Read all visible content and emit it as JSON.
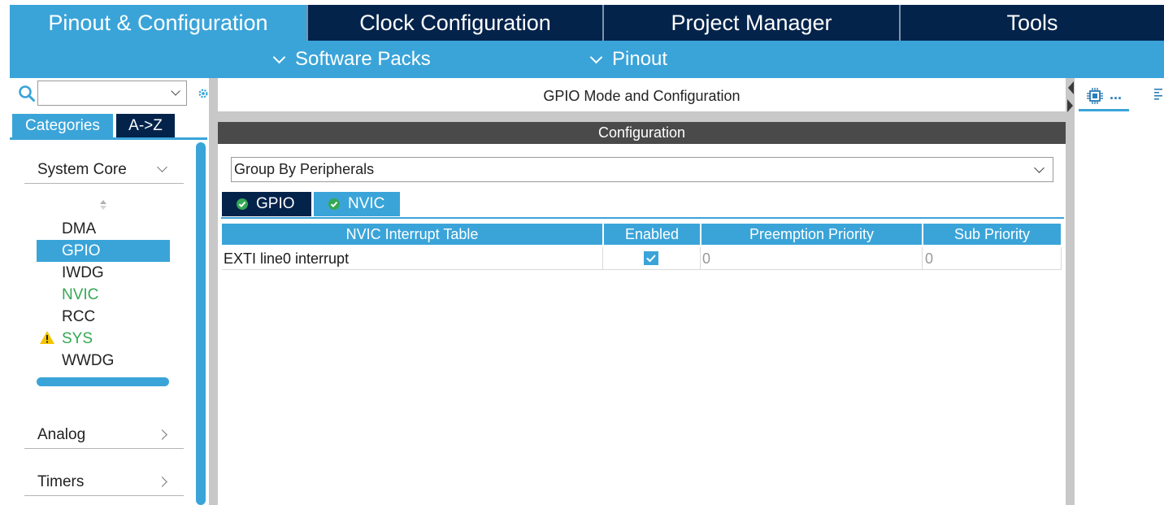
{
  "top_tabs": [
    {
      "label": "Pinout & Configuration",
      "active": true
    },
    {
      "label": "Clock Configuration",
      "active": false
    },
    {
      "label": "Project Manager",
      "active": false
    },
    {
      "label": "Tools",
      "active": false
    }
  ],
  "sub_menu": [
    "Software Packs",
    "Pinout"
  ],
  "left": {
    "search_value": "",
    "tabs": [
      {
        "label": "Categories",
        "active": true
      },
      {
        "label": "A->Z",
        "active": false
      }
    ],
    "categories": [
      {
        "label": "System Core",
        "expanded": true
      },
      {
        "label": "Analog",
        "expanded": false
      },
      {
        "label": "Timers",
        "expanded": false
      }
    ],
    "peripherals": [
      {
        "label": "DMA",
        "state": "normal"
      },
      {
        "label": "GPIO",
        "state": "selected"
      },
      {
        "label": "IWDG",
        "state": "normal"
      },
      {
        "label": "NVIC",
        "state": "configured"
      },
      {
        "label": "RCC",
        "state": "normal"
      },
      {
        "label": "SYS",
        "state": "warning"
      },
      {
        "label": "WWDG",
        "state": "normal"
      }
    ]
  },
  "main": {
    "title": "GPIO Mode and Configuration",
    "config_header": "Configuration",
    "group_select": "Group By Peripherals",
    "tabs": [
      {
        "label": "GPIO",
        "active": false
      },
      {
        "label": "NVIC",
        "active": true
      }
    ],
    "table": {
      "columns": [
        "NVIC Interrupt Table",
        "Enabled",
        "Preemption Priority",
        "Sub Priority"
      ],
      "rows": [
        {
          "name": "EXTI line0 interrupt",
          "enabled": true,
          "preemption": "0",
          "sub": "0"
        }
      ]
    }
  },
  "right": {
    "tab_label": "..."
  },
  "colors": {
    "accent": "#3aa4d9",
    "dark": "#03234b",
    "header_gray": "#4a4a4a",
    "green": "#34a853",
    "warning": "#f5c400"
  }
}
